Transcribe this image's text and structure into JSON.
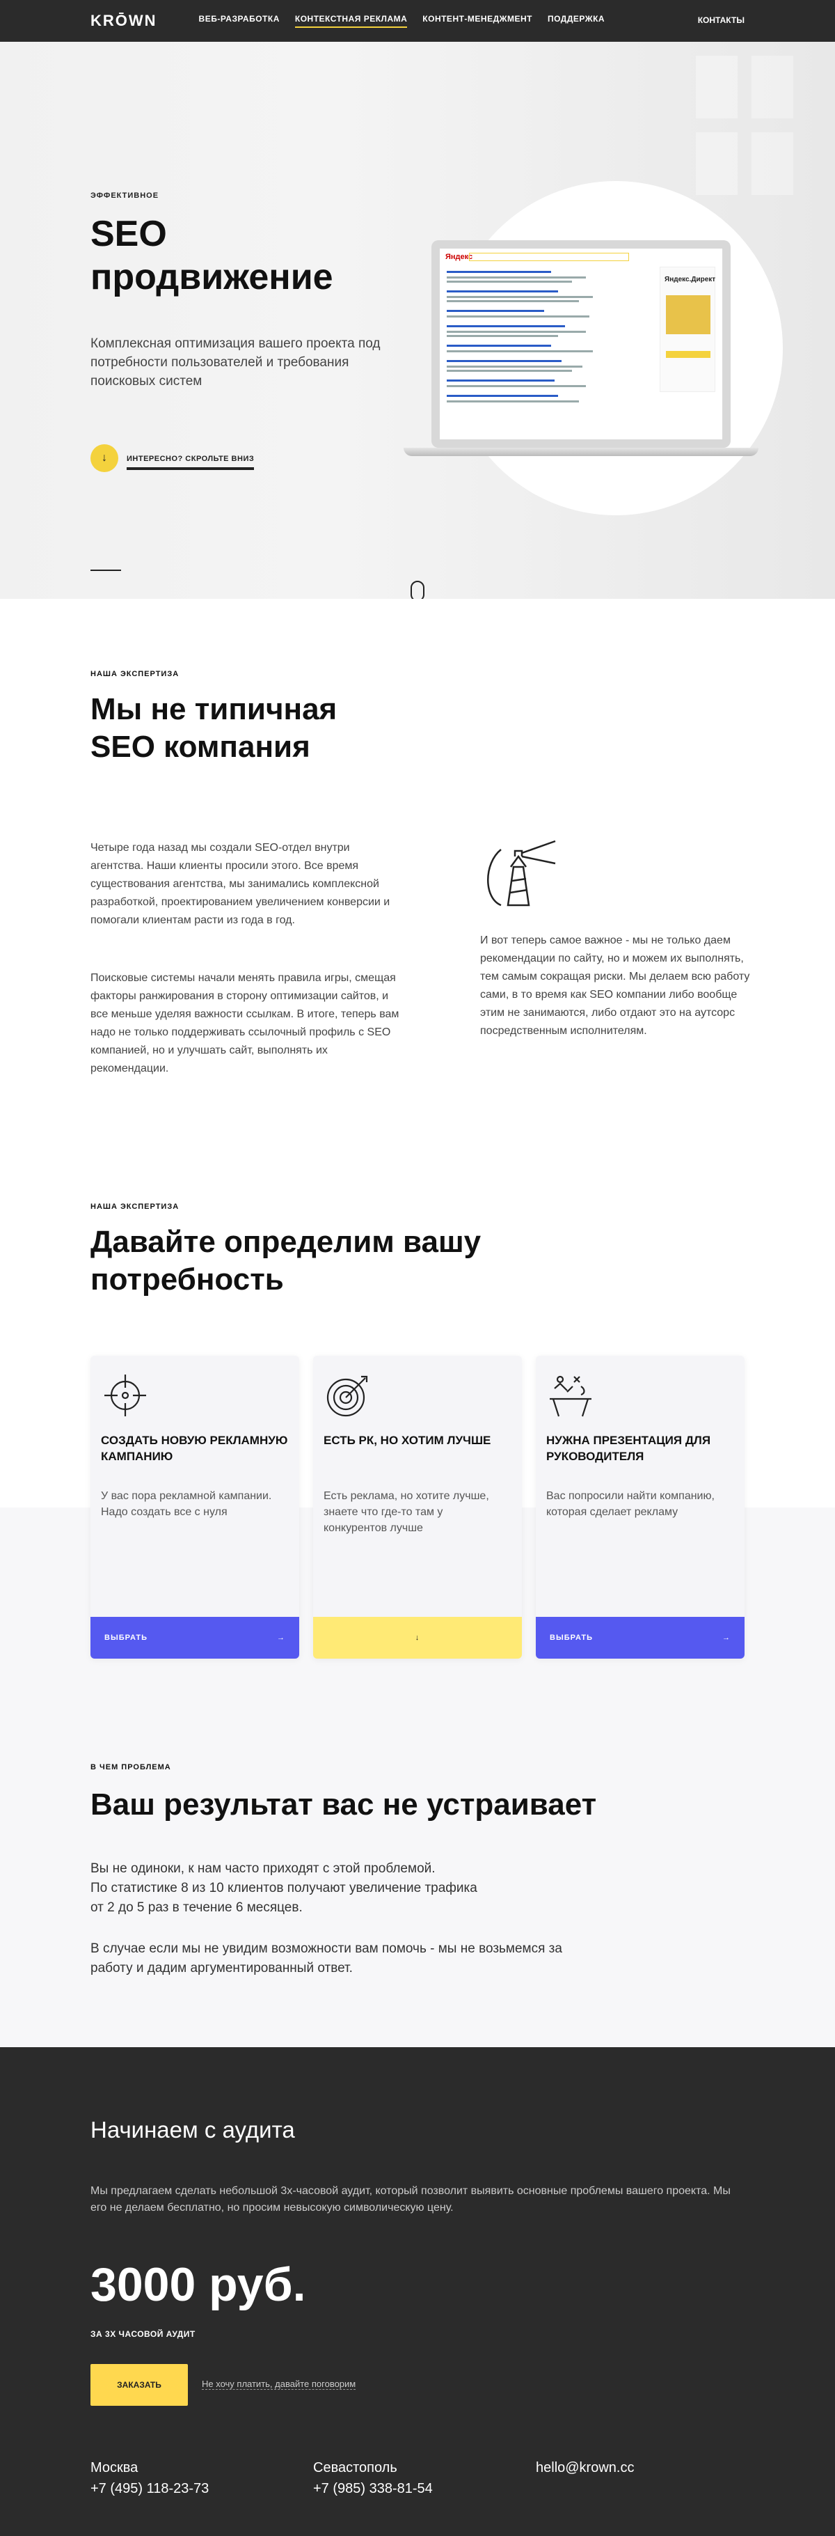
{
  "nav": {
    "logo": "KRŌWN",
    "items": [
      "ВЕБ-РАЗРАБОТКА",
      "КОНТЕКСТНАЯ РЕКЛАМА",
      "КОНТЕНТ-МЕНЕДЖМЕНТ",
      "ПОДДЕРЖКА"
    ],
    "active_item": "КОНТЕКСТНАЯ РЕКЛАМА",
    "contacts": "КОНТАКТЫ"
  },
  "hero": {
    "kicker": "ЭФФЕКТИВНОЕ",
    "title_line1": "SEO",
    "title_line2": "продвижение",
    "subtitle": "Комплексная оптимизация вашего проекта под потребности пользователей и требования поисковых систем",
    "scroll_label": "ИНТЕРЕСНО? СКРОЛЬТЕ ВНИЗ",
    "screen_logo": "Яндекс",
    "screen_ad": "Яндекс.Директ"
  },
  "expertise": {
    "kicker": "НАША ЭКСПЕРТИЗА",
    "title_line1": "Мы не типичная",
    "title_line2": "SEO компания",
    "p1": "Четыре года назад мы создали SEO-отдел внутри агентства. Наши клиенты просили этого. Все время существования агентства, мы занимались комплексной разработкой, проектированием увеличением конверсии и помогали клиентам расти из года в год.",
    "p2": "Поисковые системы начали менять правила игры, смещая факторы ранжирования в сторону оптимизации сайтов, и все меньше уделяя важности ссылкам. В итоге, теперь вам надо не только поддерживать ссылочный профиль с SEO компанией, но и улучшать сайт, выполнять их рекомендации.",
    "p3": "И вот теперь самое важное - мы не только даем рекомендации по сайту, но и можем их выполнять, тем самым сокращая риски. Мы делаем всю работу сами, в то время как SEO компании либо вообще этим не занимаются, либо отдают это на аутсорс посредственным исполнителям."
  },
  "needs": {
    "kicker": "НАША ЭКСПЕРТИЗА",
    "title_line1": "Давайте определим вашу",
    "title_line2": "потребность",
    "cards": [
      {
        "title": "СОЗДАТЬ НОВУЮ РЕКЛАМНУЮ КАМПАНИЮ",
        "desc": "У вас пора рекламной кампании. Надо создать все с нуля",
        "button": "ВЫБРАТЬ",
        "icon": "crosshair-icon"
      },
      {
        "title": "ЕСТЬ РК, НО ХОТИМ ЛУЧШЕ",
        "desc": "Есть реклама, но хотите лучше, знаете что где-то там у конкурентов лучше",
        "button": "",
        "icon": "target-arrow-icon"
      },
      {
        "title": "НУЖНА ПРЕЗЕНТАЦИЯ ДЛЯ РУКОВОДИТЕЛЯ",
        "desc": "Вас попросили найти компанию, которая сделает рекламу",
        "button": "ВЫБРАТЬ",
        "icon": "strategy-board-icon"
      }
    ]
  },
  "problem": {
    "kicker": "В ЧЕМ ПРОБЛЕМА",
    "title": "Ваш результат вас не устраивает",
    "p1_line1": "Вы не одиноки, к нам часто приходят с этой проблемой.",
    "p1_line2": "По статистике 8 из 10 клиентов получают увеличение трафика",
    "p1_line3": "от 2 до 5 раз в течение 6 месяцев.",
    "p2": "В случае если мы не увидим возможности вам помочь - мы не возьмемся за работу и дадим аргументированный ответ."
  },
  "audit": {
    "title": "Начинаем с аудита",
    "desc": "Мы предлагаем сделать небольшой 3х-часовой аудит, который позволит выявить основные проблемы вашего проекта. Мы его не делаем бесплатно, но просим невысокую символическую цену.",
    "price": "3000 руб.",
    "price_sub": "ЗА 3Х ЧАСОВОЙ АУДИТ",
    "order_button": "ЗАКАЗАТЬ",
    "talk_link": "Не хочу платить, давайте поговорим"
  },
  "contacts": {
    "city1": "Москва",
    "phone1": "+7 (495) 118-23-73",
    "city2": "Севастополь",
    "phone2": "+7 (985) 338-81-54",
    "email": "hello@krown.cc"
  }
}
